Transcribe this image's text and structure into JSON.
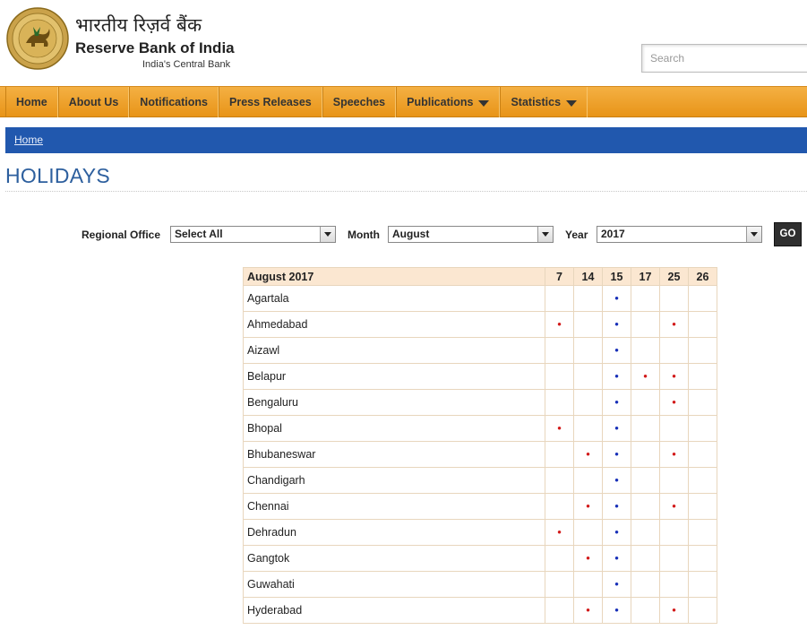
{
  "header": {
    "hindi_name": "भारतीय रिज़र्व बैंक",
    "org_name": "Reserve Bank of India",
    "tagline": "India's Central Bank",
    "search_placeholder": "Search"
  },
  "nav": {
    "items": [
      {
        "label": "Home",
        "has_dropdown": false
      },
      {
        "label": "About Us",
        "has_dropdown": false
      },
      {
        "label": "Notifications",
        "has_dropdown": false
      },
      {
        "label": "Press Releases",
        "has_dropdown": false
      },
      {
        "label": "Speeches",
        "has_dropdown": false
      },
      {
        "label": "Publications",
        "has_dropdown": true
      },
      {
        "label": "Statistics",
        "has_dropdown": true
      }
    ]
  },
  "breadcrumb": {
    "home": "Home"
  },
  "page_title": "HOLIDAYS",
  "filters": {
    "regional_office": {
      "label": "Regional Office",
      "value": "Select All"
    },
    "month": {
      "label": "Month",
      "value": "August"
    },
    "year": {
      "label": "Year",
      "value": "2017"
    },
    "go_label": "GO"
  },
  "table": {
    "caption": "August 2017",
    "dates": [
      "7",
      "14",
      "15",
      "17",
      "25",
      "26"
    ],
    "dot_symbol": "•",
    "colors": {
      "red": "#d21a1a",
      "blue": "#1830b8",
      "header_bg": "#fbe7d1",
      "nav_orange": "#f0a22e",
      "breadcrumb_blue": "#2158ae",
      "title_blue": "#2d5f9e"
    },
    "rows": [
      {
        "city": "Agartala",
        "marks": [
          "",
          "",
          "blue",
          "",
          "",
          ""
        ]
      },
      {
        "city": "Ahmedabad",
        "marks": [
          "red",
          "",
          "blue",
          "",
          "red",
          ""
        ]
      },
      {
        "city": "Aizawl",
        "marks": [
          "",
          "",
          "blue",
          "",
          "",
          ""
        ]
      },
      {
        "city": "Belapur",
        "marks": [
          "",
          "",
          "blue",
          "red",
          "red",
          ""
        ]
      },
      {
        "city": "Bengaluru",
        "marks": [
          "",
          "",
          "blue",
          "",
          "red",
          ""
        ]
      },
      {
        "city": "Bhopal",
        "marks": [
          "red",
          "",
          "blue",
          "",
          "",
          ""
        ]
      },
      {
        "city": "Bhubaneswar",
        "marks": [
          "",
          "red",
          "blue",
          "",
          "red",
          ""
        ]
      },
      {
        "city": "Chandigarh",
        "marks": [
          "",
          "",
          "blue",
          "",
          "",
          ""
        ]
      },
      {
        "city": "Chennai",
        "marks": [
          "",
          "red",
          "blue",
          "",
          "red",
          ""
        ]
      },
      {
        "city": "Dehradun",
        "marks": [
          "red",
          "",
          "blue",
          "",
          "",
          ""
        ]
      },
      {
        "city": "Gangtok",
        "marks": [
          "",
          "red",
          "blue",
          "",
          "",
          ""
        ]
      },
      {
        "city": "Guwahati",
        "marks": [
          "",
          "",
          "blue",
          "",
          "",
          ""
        ]
      },
      {
        "city": "Hyderabad",
        "marks": [
          "",
          "red",
          "blue",
          "",
          "red",
          ""
        ]
      }
    ]
  }
}
